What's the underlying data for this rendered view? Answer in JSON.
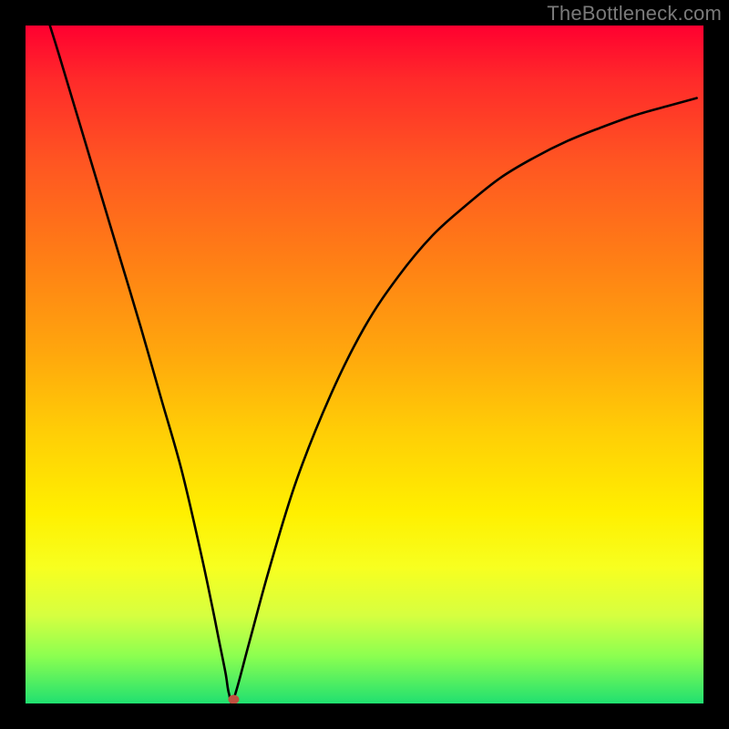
{
  "watermark": "TheBottleneck.com",
  "chart_data": {
    "type": "line",
    "title": "",
    "xlabel": "",
    "ylabel": "",
    "xlim": [
      0,
      1
    ],
    "ylim": [
      0,
      1
    ],
    "grid": false,
    "legend": false,
    "gradient_fill": {
      "from": "#ff0030",
      "to": "#20e070",
      "direction": "top-to-bottom"
    },
    "marker": {
      "x": 0.307,
      "y": 0.006,
      "color": "#c05040"
    },
    "series": [
      {
        "name": "curve",
        "color": "#000000",
        "x": [
          0.036,
          0.05,
          0.08,
          0.11,
          0.14,
          0.17,
          0.2,
          0.23,
          0.258,
          0.275,
          0.285,
          0.295,
          0.3,
          0.307,
          0.33,
          0.36,
          0.4,
          0.45,
          0.5,
          0.55,
          0.6,
          0.65,
          0.7,
          0.75,
          0.8,
          0.85,
          0.9,
          0.95,
          0.99
        ],
        "y": [
          1.0,
          0.955,
          0.855,
          0.755,
          0.655,
          0.555,
          0.45,
          0.345,
          0.225,
          0.145,
          0.095,
          0.045,
          0.015,
          0.007,
          0.09,
          0.2,
          0.33,
          0.455,
          0.555,
          0.63,
          0.69,
          0.735,
          0.775,
          0.805,
          0.83,
          0.85,
          0.868,
          0.882,
          0.893
        ]
      }
    ]
  }
}
